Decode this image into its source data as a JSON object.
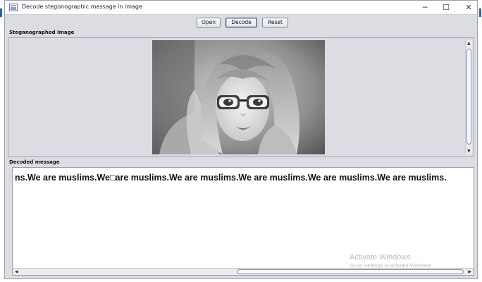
{
  "window": {
    "title": "Decode stegonographic message in image",
    "controls": {
      "minimize": "─",
      "maximize": "☐",
      "close": "✕"
    }
  },
  "toolbar": {
    "open_label": "Open",
    "decode_label": "Decode",
    "reset_label": "Reset"
  },
  "image_section": {
    "label": "Steganographed Image",
    "photo_icon": "portrait-photo"
  },
  "message_section": {
    "label": "Decoded message",
    "text": "ns.We are muslims.We□are muslims.We are muslims.We are muslims.We are muslims.We are muslims."
  },
  "watermark": {
    "title": "Activate Windows",
    "subtitle": "Go to Settings to activate Windows."
  },
  "scroll_arrows": {
    "up": "▲",
    "down": "▼",
    "left": "◀",
    "right": "▶"
  }
}
